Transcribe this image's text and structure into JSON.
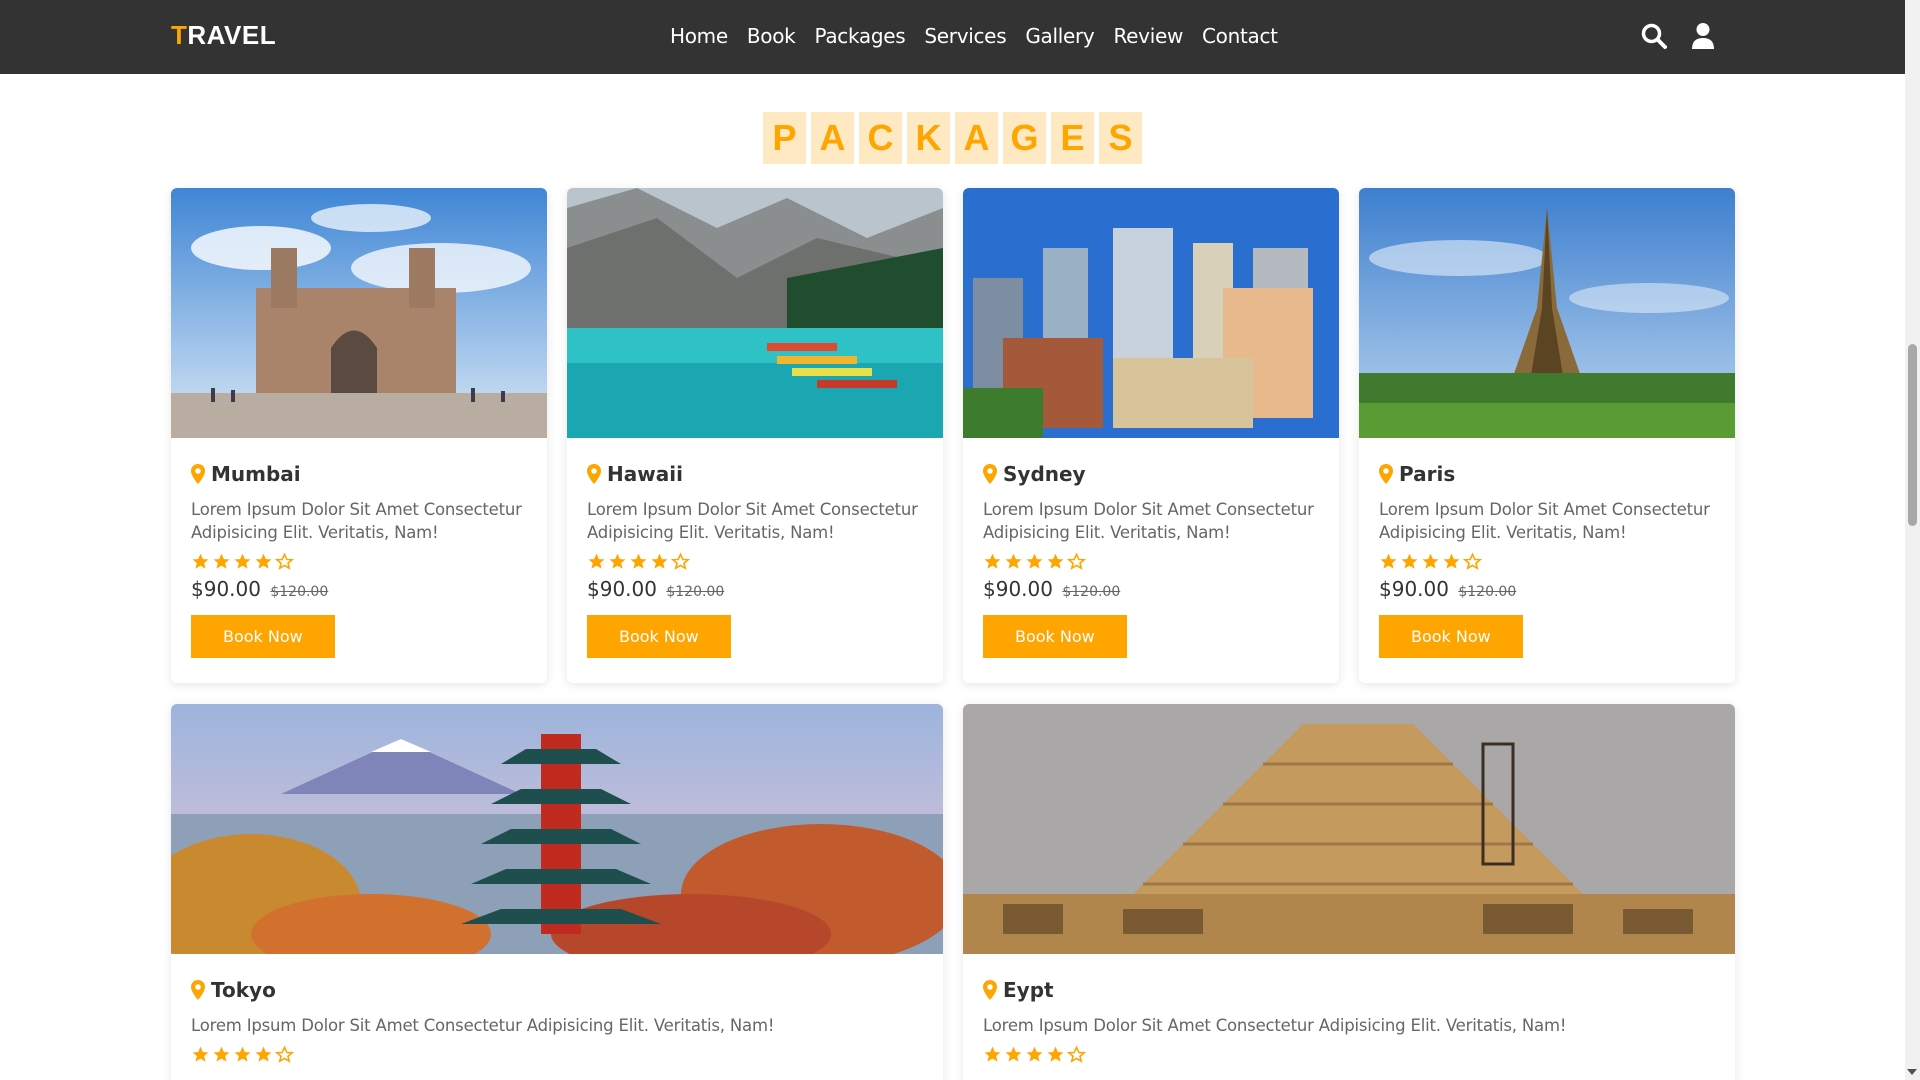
{
  "header": {
    "logo_first": "T",
    "logo_rest": "RAVEL",
    "nav": [
      "Home",
      "Book",
      "Packages",
      "Services",
      "Gallery",
      "Review",
      "Contact"
    ],
    "icons": [
      "search-icon",
      "user-icon"
    ]
  },
  "heading": {
    "letters": [
      "P",
      "A",
      "C",
      "K",
      "A",
      "G",
      "E",
      "S"
    ]
  },
  "colors": {
    "accent": "#ffa500",
    "header_bg": "#333333",
    "heading_bg": "#ffe9c2"
  },
  "packages": [
    {
      "name": "Mumbai",
      "description": "Lorem Ipsum Dolor Sit Amet Consectetur Adipisicing Elit. Veritatis, Nam!",
      "rating": 4,
      "rating_max": 5,
      "price": "$90.00",
      "old_price": "$120.00",
      "button": "Book Now"
    },
    {
      "name": "Hawaii",
      "description": "Lorem Ipsum Dolor Sit Amet Consectetur Adipisicing Elit. Veritatis, Nam!",
      "rating": 4,
      "rating_max": 5,
      "price": "$90.00",
      "old_price": "$120.00",
      "button": "Book Now"
    },
    {
      "name": "Sydney",
      "description": "Lorem Ipsum Dolor Sit Amet Consectetur Adipisicing Elit. Veritatis, Nam!",
      "rating": 4,
      "rating_max": 5,
      "price": "$90.00",
      "old_price": "$120.00",
      "button": "Book Now"
    },
    {
      "name": "Paris",
      "description": "Lorem Ipsum Dolor Sit Amet Consectetur Adipisicing Elit. Veritatis, Nam!",
      "rating": 4,
      "rating_max": 5,
      "price": "$90.00",
      "old_price": "$120.00",
      "button": "Book Now"
    },
    {
      "name": "Tokyo",
      "description": "Lorem Ipsum Dolor Sit Amet Consectetur Adipisicing Elit. Veritatis, Nam!",
      "rating": 4,
      "rating_max": 5
    },
    {
      "name": "Eypt",
      "description": "Lorem Ipsum Dolor Sit Amet Consectetur Adipisicing Elit. Veritatis, Nam!",
      "rating": 4,
      "rating_max": 5
    }
  ]
}
